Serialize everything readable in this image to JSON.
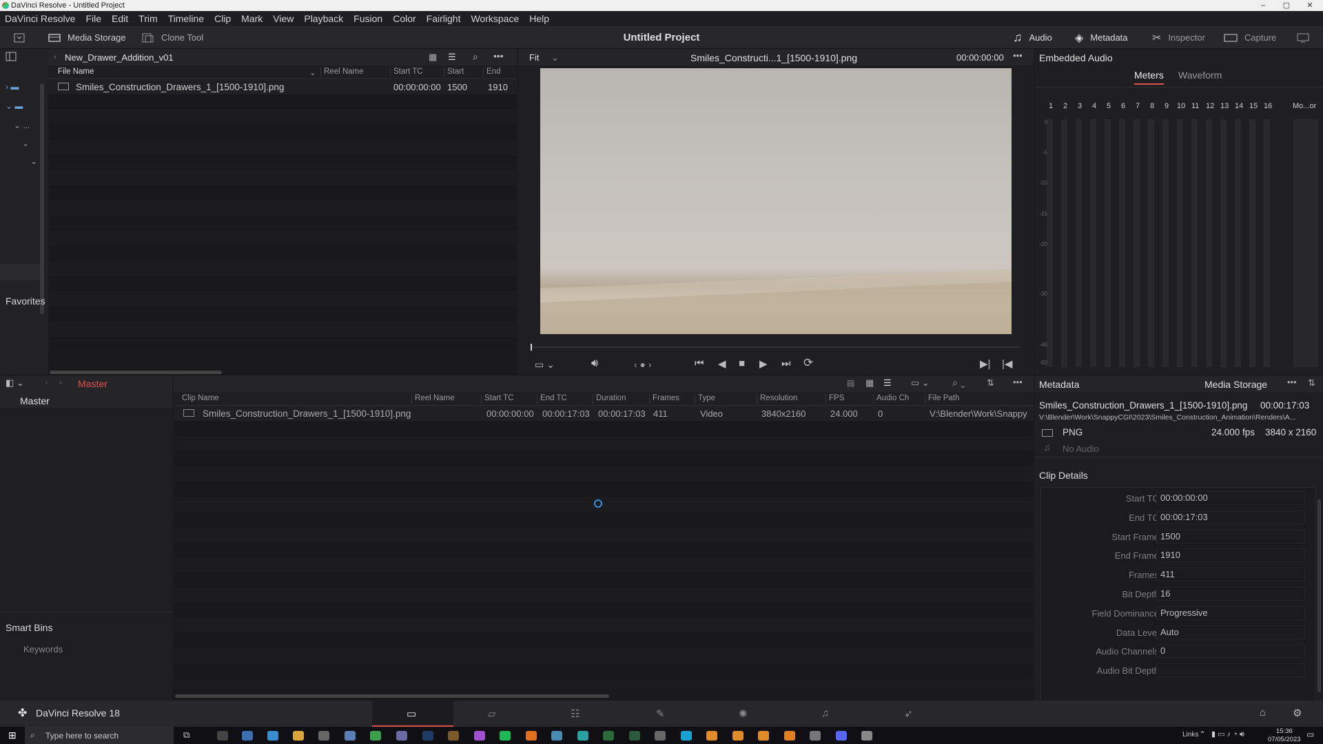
{
  "window": {
    "title": "DaVinci Resolve - Untitled Project",
    "min": "–",
    "max": "▢",
    "close": "✕"
  },
  "menu": [
    "DaVinci Resolve",
    "File",
    "Edit",
    "Trim",
    "Timeline",
    "Clip",
    "Mark",
    "View",
    "Playback",
    "Fusion",
    "Color",
    "Fairlight",
    "Workspace",
    "Help"
  ],
  "toolbar": {
    "media_storage": "Media Storage",
    "clone_tool": "Clone Tool",
    "project_title": "Untitled Project",
    "audio": "Audio",
    "metadata": "Metadata",
    "inspector": "Inspector",
    "capture": "Capture"
  },
  "media_storage": {
    "folder": "New_Drawer_Addition_v01",
    "columns": [
      "File Name",
      "Reel Name",
      "Start TC",
      "Start",
      "End"
    ],
    "row": {
      "name": "Smiles_Construction_Drawers_1_[1500-1910].png",
      "reel": "",
      "start_tc": "00:00:00:00",
      "start": "1500",
      "end": "1910"
    },
    "favorites": "Favorites",
    "tree_dots": "..."
  },
  "viewer": {
    "fit": "Fit",
    "clip": "Smiles_Constructi...1_[1500-1910].png",
    "timecode": "00:00:00:00"
  },
  "audio_panel": {
    "title": "Embedded Audio",
    "tabs": [
      "Meters",
      "Waveform"
    ],
    "channels": [
      "1",
      "2",
      "3",
      "4",
      "5",
      "6",
      "7",
      "8",
      "9",
      "10",
      "11",
      "12",
      "13",
      "14",
      "15",
      "16"
    ],
    "monitor": "Mo...or",
    "scale": [
      "0",
      "-5",
      "-10",
      "-15",
      "-20",
      "-30",
      "-40",
      "-50"
    ]
  },
  "media_pool": {
    "bin": "Master",
    "sidebar_master": "Master",
    "smart_bins": "Smart Bins",
    "keywords": "Keywords",
    "columns": [
      "Clip Name",
      "Reel Name",
      "Start TC",
      "End TC",
      "Duration",
      "Frames",
      "Type",
      "Resolution",
      "FPS",
      "Audio Ch",
      "File Path"
    ],
    "row": {
      "name": "Smiles_Construction_Drawers_1_[1500-1910].png",
      "reel": "",
      "start_tc": "00:00:00:00",
      "end_tc": "00:00:17:03",
      "duration": "00:00:17:03",
      "frames": "411",
      "type": "Video",
      "resolution": "3840x2160",
      "fps": "24.000",
      "audio_ch": "0",
      "path": "V:\\Blender\\Work\\Snappy"
    }
  },
  "metadata": {
    "title": "Metadata",
    "source": "Media Storage",
    "clip": "Smiles_Construction_Drawers_1_[1500-1910].png",
    "duration": "00:00:17:03",
    "path": "V:\\Blender\\Work\\SnappyCGI\\2023\\Smiles_Construction_Animation\\Renders\\A...",
    "format": "PNG",
    "fps": "24.000 fps",
    "res": "3840 x 2160",
    "audio": "No Audio",
    "section": "Clip Details",
    "fields": [
      {
        "k": "Start TC",
        "v": "00:00:00:00"
      },
      {
        "k": "End TC",
        "v": "00:00:17:03"
      },
      {
        "k": "Start Frame",
        "v": "1500"
      },
      {
        "k": "End Frame",
        "v": "1910"
      },
      {
        "k": "Frames",
        "v": "411"
      },
      {
        "k": "Bit Depth",
        "v": "16"
      },
      {
        "k": "Field Dominance",
        "v": "Progressive"
      },
      {
        "k": "Data Level",
        "v": "Auto"
      },
      {
        "k": "Audio Channels",
        "v": "0"
      },
      {
        "k": "Audio Bit Depth",
        "v": ""
      }
    ]
  },
  "bottom": {
    "app": "DaVinci Resolve 18"
  },
  "taskbar": {
    "search": "Type here to search",
    "links": "Links",
    "time": "15:36",
    "date": "07/05/2023"
  }
}
